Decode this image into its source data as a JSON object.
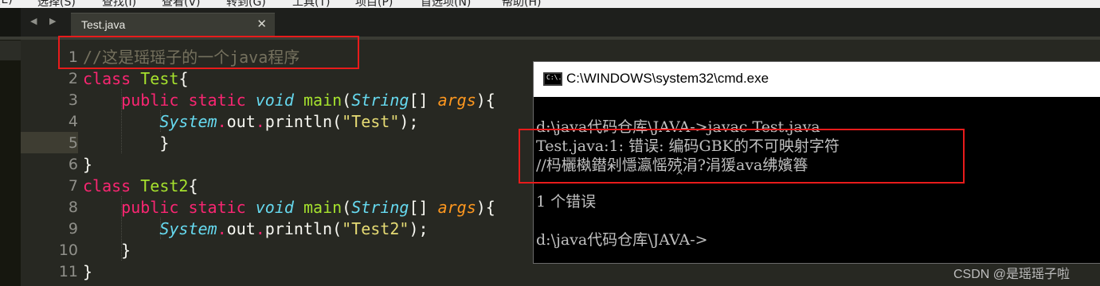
{
  "menu": {
    "items": [
      "(E)",
      "选择(S)",
      "查找(I)",
      "查看(V)",
      "转到(G)",
      "工具(T)",
      "项目(P)",
      "首选项(N)",
      "帮助(H)"
    ]
  },
  "tabs": [
    {
      "title": "Test.java",
      "close": "✕"
    }
  ],
  "nav_arrows": "◀ ▶",
  "editor": {
    "active_line": 5,
    "line_numbers": [
      "1",
      "2",
      "3",
      "4",
      "5",
      "6",
      "7",
      "8",
      "9",
      "10",
      "11"
    ],
    "code": {
      "l1": "//这是瑶瑶子的一个java程序",
      "l2_kw": "class",
      "l2_name": "Test",
      "l2_brace": "{",
      "l3_mod1": "public",
      "l3_mod2": "static",
      "l3_type": "void",
      "l3_fn": "main",
      "l3_p1": "(",
      "l3_ptype": "String",
      "l3_p2": "[] ",
      "l3_pname": "args",
      "l3_p3": "){",
      "l4_cls": "System",
      "l4_dot1": ".",
      "l4_out": "out",
      "l4_dot2": ".",
      "l4_fn": "println",
      "l4_p1": "(",
      "l4_str": "\"Test\"",
      "l4_p2": ");",
      "l5": "}",
      "l6": "}",
      "l7_kw": "class",
      "l7_name": "Test2",
      "l7_brace": "{",
      "l8_mod1": "public",
      "l8_mod2": "static",
      "l8_type": "void",
      "l8_fn": "main",
      "l8_p1": "(",
      "l8_ptype": "String",
      "l8_p2": "[] ",
      "l8_pname": "args",
      "l8_p3": "){",
      "l9_cls": "System",
      "l9_dot1": ".",
      "l9_out": "out",
      "l9_dot2": ".",
      "l9_fn": "println",
      "l9_p1": "(",
      "l9_str": "\"Test2\"",
      "l9_p2": ");",
      "l10": "}",
      "l11": "}"
    }
  },
  "cmd": {
    "title": "C:\\WINDOWS\\system32\\cmd.exe",
    "icon_label": "C:\\.",
    "lines": [
      "d:\\java代码仓库\\JAVA->javac Test.java",
      "Test.java:1: 错误: 编码GBK的不可映射字符",
      "//杩欐槸鐟剁懚瀛愮殑涓?涓猨ava绋嬪簭",
      "^",
      "1 个错误",
      "d:\\java代码仓库\\JAVA->"
    ]
  },
  "watermark": "CSDN @是瑶瑶子啦",
  "colors": {
    "editor_bg": "#272822",
    "keyword": "#f92672",
    "type": "#66d9ef",
    "function": "#a6e22e",
    "param": "#fd971f",
    "string": "#e6db74",
    "comment": "#75715e",
    "highlight_box": "#e81b1b"
  }
}
